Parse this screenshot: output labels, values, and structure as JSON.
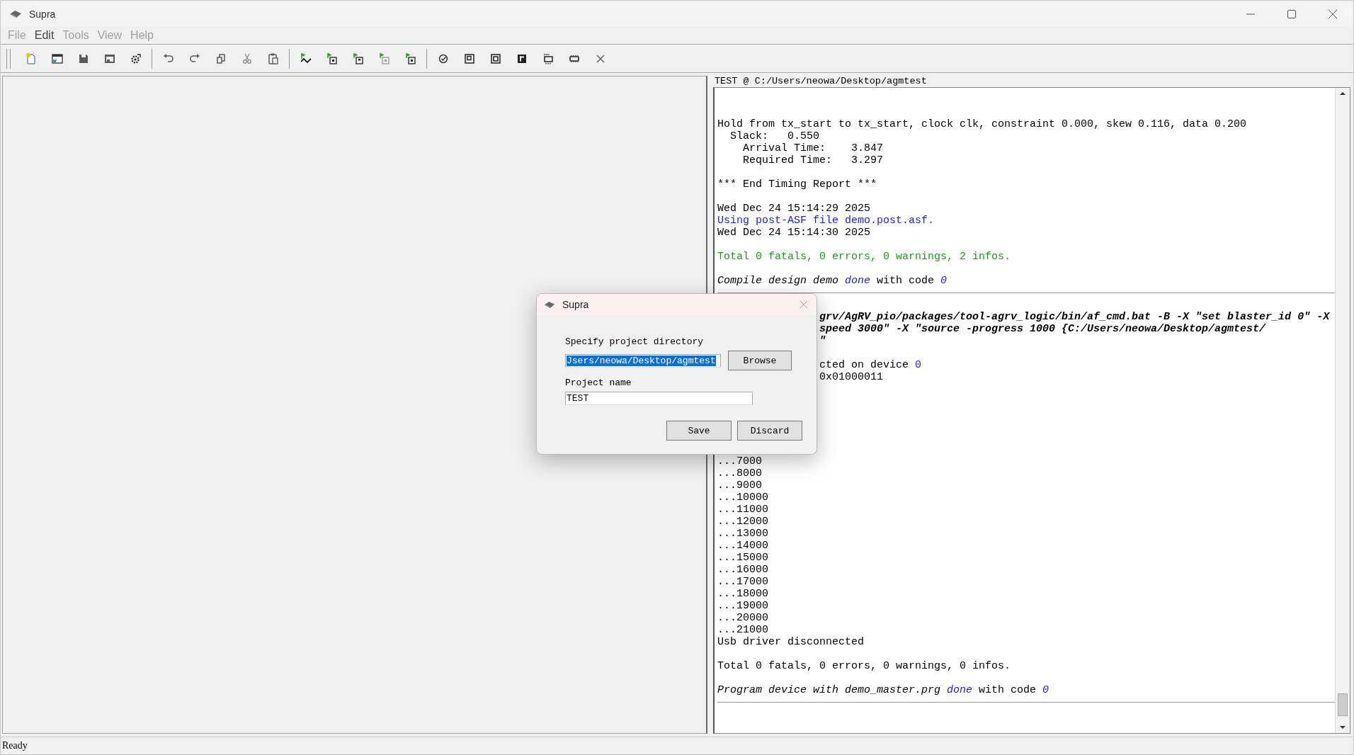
{
  "window": {
    "title": "Supra"
  },
  "menu": [
    {
      "label": "File",
      "disabled": true
    },
    {
      "label": "Edit",
      "disabled": false
    },
    {
      "label": "Tools",
      "disabled": true
    },
    {
      "label": "View",
      "disabled": true
    },
    {
      "label": "Help",
      "disabled": true
    }
  ],
  "log_panel": {
    "header": "TEST @ C:/Users/neowa/Desktop/agmtest",
    "lines": [
      {
        "kind": "blank"
      },
      {
        "kind": "blank"
      },
      {
        "kind": "text",
        "spans": [
          {
            "text": "Hold from tx_start to tx_start, clock clk, constraint 0.000, skew 0.116, data 0.200",
            "color": "#000000"
          }
        ]
      },
      {
        "kind": "text",
        "spans": [
          {
            "text": "  Slack:   0.550",
            "color": "#000000"
          }
        ]
      },
      {
        "kind": "text",
        "spans": [
          {
            "text": "    Arrival Time:    3.847",
            "color": "#000000"
          }
        ]
      },
      {
        "kind": "text",
        "spans": [
          {
            "text": "    Required Time:   3.297",
            "color": "#000000"
          }
        ]
      },
      {
        "kind": "blank"
      },
      {
        "kind": "text",
        "spans": [
          {
            "text": "*** End Timing Report ***",
            "color": "#000000"
          }
        ]
      },
      {
        "kind": "blank"
      },
      {
        "kind": "text",
        "spans": [
          {
            "text": "Wed Dec 24 15:14:29 2025",
            "color": "#000000"
          }
        ]
      },
      {
        "kind": "text",
        "spans": [
          {
            "text": "Using post-ASF file demo.post.asf.",
            "color": "#1a1aff"
          }
        ]
      },
      {
        "kind": "text",
        "spans": [
          {
            "text": "Wed Dec 24 15:14:30 2025",
            "color": "#000000"
          }
        ]
      },
      {
        "kind": "blank"
      },
      {
        "kind": "text",
        "spans": [
          {
            "text": "Total 0 fatals, 0 errors, 0 warnings, 2 infos.",
            "color": "#1e9a1e"
          }
        ]
      },
      {
        "kind": "blank"
      },
      {
        "kind": "text",
        "spans": [
          {
            "text": "Compile design demo ",
            "color": "#000000",
            "italic": true
          },
          {
            "text": "done",
            "color": "#1a1aff",
            "italic": true
          },
          {
            "text": " with code ",
            "color": "#000000"
          },
          {
            "text": "0",
            "color": "#1a1aff",
            "italic": true
          }
        ]
      },
      {
        "kind": "rule"
      },
      {
        "kind": "blank"
      },
      {
        "kind": "partial",
        "spans": [
          {
            "text": "grv/AgRV_pio/packages/tool-agrv_logic/bin/af_cmd.bat -B -X \"set blaster_id 0\" -X",
            "color": "#000000",
            "italic": true,
            "bold": true
          }
        ]
      },
      {
        "kind": "partial",
        "spans": [
          {
            "text": "speed 3000\" -X \"source -progress 1000 {C:/Users/neowa/Desktop/agmtest/",
            "color": "#000000",
            "italic": true,
            "bold": true
          }
        ]
      },
      {
        "kind": "partial",
        "spans": [
          {
            "text": "\"",
            "color": "#000000",
            "italic": true,
            "bold": true
          }
        ]
      },
      {
        "kind": "blank"
      },
      {
        "kind": "partial",
        "spans": [
          {
            "text": "cted on device ",
            "color": "#000000"
          },
          {
            "text": "0",
            "color": "#1a1aff"
          }
        ]
      },
      {
        "kind": "partial",
        "spans": [
          {
            "text": "0x01000011",
            "color": "#000000"
          }
        ]
      },
      {
        "kind": "blank"
      },
      {
        "kind": "blank"
      },
      {
        "kind": "blank"
      },
      {
        "kind": "blank"
      },
      {
        "kind": "blank"
      },
      {
        "kind": "blank"
      },
      {
        "kind": "text",
        "spans": [
          {
            "text": "...7000",
            "color": "#000000"
          }
        ]
      },
      {
        "kind": "text",
        "spans": [
          {
            "text": "...8000",
            "color": "#000000"
          }
        ]
      },
      {
        "kind": "text",
        "spans": [
          {
            "text": "...9000",
            "color": "#000000"
          }
        ]
      },
      {
        "kind": "text",
        "spans": [
          {
            "text": "...10000",
            "color": "#000000"
          }
        ]
      },
      {
        "kind": "text",
        "spans": [
          {
            "text": "...11000",
            "color": "#000000"
          }
        ]
      },
      {
        "kind": "text",
        "spans": [
          {
            "text": "...12000",
            "color": "#000000"
          }
        ]
      },
      {
        "kind": "text",
        "spans": [
          {
            "text": "...13000",
            "color": "#000000"
          }
        ]
      },
      {
        "kind": "text",
        "spans": [
          {
            "text": "...14000",
            "color": "#000000"
          }
        ]
      },
      {
        "kind": "text",
        "spans": [
          {
            "text": "...15000",
            "color": "#000000"
          }
        ]
      },
      {
        "kind": "text",
        "spans": [
          {
            "text": "...16000",
            "color": "#000000"
          }
        ]
      },
      {
        "kind": "text",
        "spans": [
          {
            "text": "...17000",
            "color": "#000000"
          }
        ]
      },
      {
        "kind": "text",
        "spans": [
          {
            "text": "...18000",
            "color": "#000000"
          }
        ]
      },
      {
        "kind": "text",
        "spans": [
          {
            "text": "...19000",
            "color": "#000000"
          }
        ]
      },
      {
        "kind": "text",
        "spans": [
          {
            "text": "...20000",
            "color": "#000000"
          }
        ]
      },
      {
        "kind": "text",
        "spans": [
          {
            "text": "...21000",
            "color": "#000000"
          }
        ]
      },
      {
        "kind": "text",
        "spans": [
          {
            "text": "Usb driver disconnected",
            "color": "#000000"
          }
        ]
      },
      {
        "kind": "blank"
      },
      {
        "kind": "text",
        "spans": [
          {
            "text": "Total 0 fatals, 0 errors, 0 warnings, 0 infos.",
            "color": "#000000"
          }
        ]
      },
      {
        "kind": "blank"
      },
      {
        "kind": "text",
        "spans": [
          {
            "text": "Program device with demo_master.prg ",
            "color": "#000000",
            "italic": true
          },
          {
            "text": "done",
            "color": "#1a1aff",
            "italic": true
          },
          {
            "text": " with code ",
            "color": "#000000"
          },
          {
            "text": "0",
            "color": "#1a1aff",
            "italic": true
          }
        ]
      },
      {
        "kind": "rule"
      }
    ]
  },
  "dialog": {
    "title": "Supra",
    "directory": {
      "label": "Specify project directory",
      "value": "Jsers/neowa/Desktop/agmtest",
      "selected": true,
      "button": "Browse"
    },
    "name": {
      "label": "Project name",
      "value": "TEST",
      "selected": false
    },
    "buttons": [
      "Save",
      "Discard"
    ]
  },
  "status_bar": {
    "text": "Ready"
  }
}
